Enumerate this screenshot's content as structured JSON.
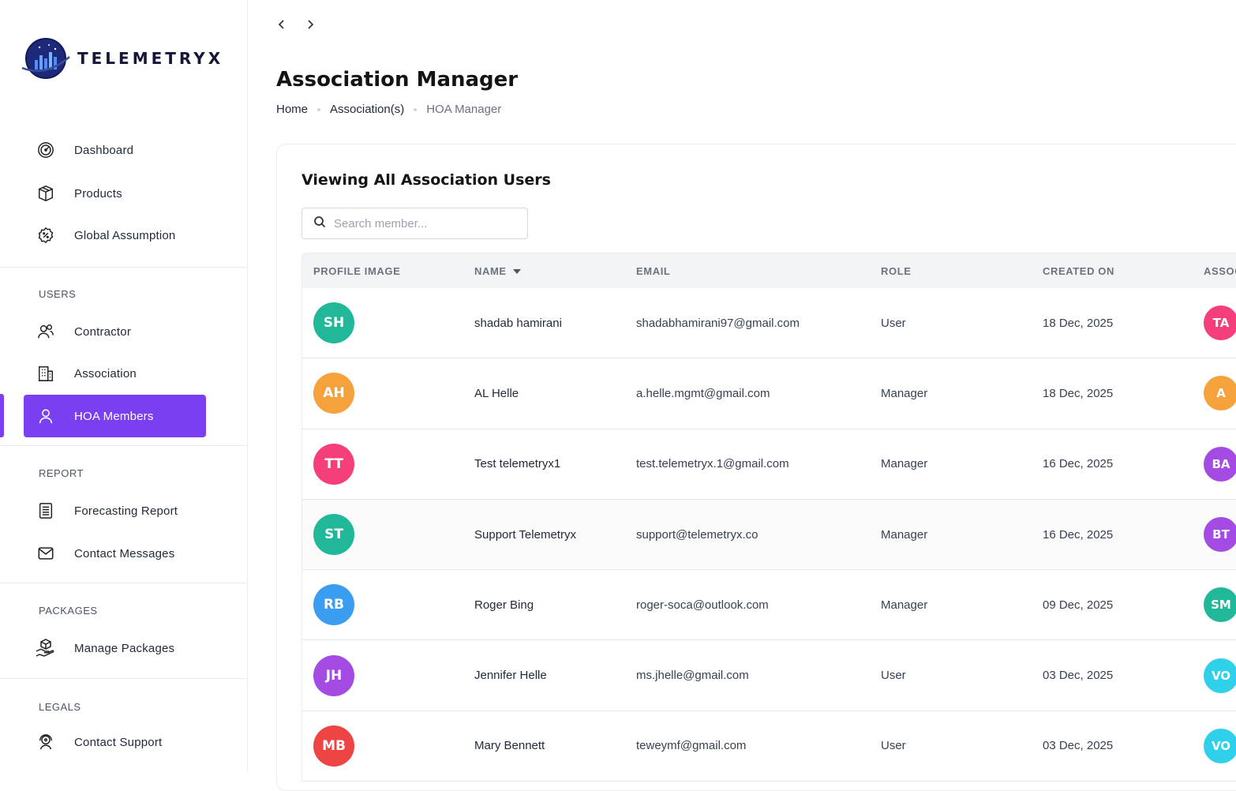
{
  "app": {
    "brand": "TELEMETRYX"
  },
  "sidebar": {
    "main_items": [
      {
        "label": "Dashboard",
        "icon": "gauge-icon"
      },
      {
        "label": "Products",
        "icon": "box-icon"
      },
      {
        "label": "Global Assumption",
        "icon": "percent-badge-icon"
      }
    ],
    "sections": [
      {
        "title": "USERS",
        "items": [
          {
            "label": "Contractor",
            "icon": "users-icon"
          },
          {
            "label": "Association",
            "icon": "building-icon"
          },
          {
            "label": "HOA Members",
            "icon": "user-icon",
            "active": true
          }
        ]
      },
      {
        "title": "REPORT",
        "items": [
          {
            "label": "Forecasting Report",
            "icon": "report-icon"
          },
          {
            "label": "Contact Messages",
            "icon": "mail-icon"
          }
        ]
      },
      {
        "title": "PACKAGES",
        "items": [
          {
            "label": "Manage Packages",
            "icon": "package-hand-icon"
          }
        ]
      },
      {
        "title": "LEGALS",
        "items": [
          {
            "label": "Contact Support",
            "icon": "support-icon"
          }
        ]
      }
    ]
  },
  "header": {
    "title": "Association Manager",
    "breadcrumb": [
      "Home",
      "Association(s)",
      "HOA Manager"
    ]
  },
  "card": {
    "title": "Viewing All Association Users",
    "search_placeholder": "Search member..."
  },
  "table": {
    "columns": [
      "PROFILE IMAGE",
      "NAME",
      "EMAIL",
      "ROLE",
      "CREATED ON",
      "ASSOC"
    ],
    "rows": [
      {
        "initials": "SH",
        "color": "#21b89a",
        "name": "shadab hamirani",
        "email": "shadabhamirani97@gmail.com",
        "role": "User",
        "created": "18 Dec, 2025",
        "assoc": "TA",
        "assoc_color": "#f43f7a"
      },
      {
        "initials": "AH",
        "color": "#f6a23c",
        "name": "AL Helle",
        "email": "a.helle.mgmt@gmail.com",
        "role": "Manager",
        "created": "18 Dec, 2025",
        "assoc": "A",
        "assoc_color": "#f6a23c"
      },
      {
        "initials": "TT",
        "color": "#f43f7a",
        "name": "Test telemetryx1",
        "email": "test.telemetryx.1@gmail.com",
        "role": "Manager",
        "created": "16 Dec, 2025",
        "assoc": "BA",
        "assoc_color": "#a44be3"
      },
      {
        "initials": "ST",
        "color": "#21b89a",
        "name": "Support Telemetryx",
        "email": "support@telemetryx.co",
        "role": "Manager",
        "created": "16 Dec, 2025",
        "assoc": "BT",
        "assoc_color": "#a44be3"
      },
      {
        "initials": "RB",
        "color": "#3b9df0",
        "name": "Roger Bing",
        "email": "roger-soca@outlook.com",
        "role": "Manager",
        "created": "09 Dec, 2025",
        "assoc": "SM",
        "assoc_color": "#21b89a"
      },
      {
        "initials": "JH",
        "color": "#a44be3",
        "name": "Jennifer Helle",
        "email": "ms.jhelle@gmail.com",
        "role": "User",
        "created": "03 Dec, 2025",
        "assoc": "VO",
        "assoc_color": "#2fd0ea"
      },
      {
        "initials": "MB",
        "color": "#ef4444",
        "name": "Mary Bennett",
        "email": "teweymf@gmail.com",
        "role": "User",
        "created": "03 Dec, 2025",
        "assoc": "VO",
        "assoc_color": "#2fd0ea"
      }
    ]
  },
  "colors": {
    "accent": "#7b3ff2"
  }
}
